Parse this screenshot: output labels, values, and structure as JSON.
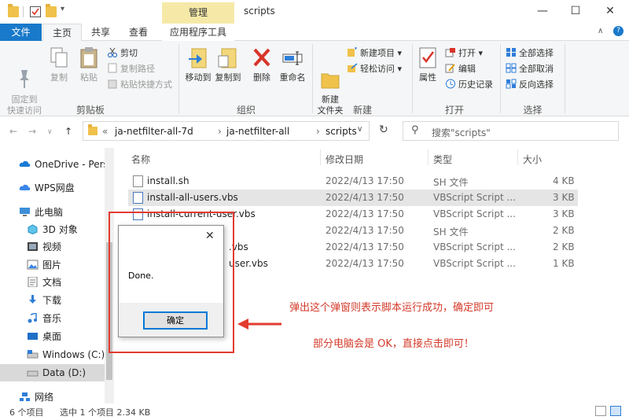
{
  "window": {
    "title": "scripts",
    "context_tab": "管理",
    "controls": [
      "—",
      "☐",
      "✕"
    ]
  },
  "ribbon_tabs": {
    "file": "文件",
    "home": "主页",
    "share": "共享",
    "view": "查看",
    "app_tools": "应用程序工具"
  },
  "clipboard": {
    "label": "剪贴板",
    "pin": "固定到\n快速访问",
    "copy": "复制",
    "paste": "粘贴",
    "cut": "剪切",
    "copy_path": "复制路径",
    "paste_shortcut": "粘贴快捷方式"
  },
  "organize": {
    "label": "组织",
    "move_to": "移动到",
    "copy_to": "复制到",
    "delete": "删除",
    "rename": "重命名"
  },
  "new_group": {
    "label": "新建",
    "new_folder": "新建\n文件夹",
    "new_item": "新建项目",
    "easy_access": "轻松访问"
  },
  "open_group": {
    "label": "打开",
    "properties": "属性",
    "open": "打开",
    "edit": "编辑",
    "history": "历史记录"
  },
  "select_group": {
    "label": "选择",
    "select_all": "全部选择",
    "select_none": "全部取消",
    "invert": "反向选择"
  },
  "address": {
    "crumbs": [
      "«",
      "ja-netfilter-all-7d",
      "ja-netfilter-all",
      "scripts"
    ],
    "search_placeholder": "搜索\"scripts\""
  },
  "nav": [
    {
      "label": "OneDrive - Pers",
      "icon": "cloud-icon"
    },
    {
      "label": "WPS网盘",
      "icon": "cloud-icon"
    },
    {
      "label": "此电脑",
      "icon": "computer-icon"
    },
    {
      "label": "3D 对象",
      "icon": "cube-icon"
    },
    {
      "label": "视频",
      "icon": "video-icon"
    },
    {
      "label": "图片",
      "icon": "picture-icon"
    },
    {
      "label": "文档",
      "icon": "document-icon"
    },
    {
      "label": "下载",
      "icon": "download-icon"
    },
    {
      "label": "音乐",
      "icon": "music-icon"
    },
    {
      "label": "桌面",
      "icon": "desktop-icon"
    },
    {
      "label": "Windows (C:)",
      "icon": "drive-icon"
    },
    {
      "label": "Data (D:)",
      "icon": "drive-icon"
    },
    {
      "label": "网络",
      "icon": "network-icon"
    }
  ],
  "columns": {
    "name": "名称",
    "date": "修改日期",
    "type": "类型",
    "size": "大小"
  },
  "files": [
    {
      "name": "install.sh",
      "date": "2022/4/13 17:50",
      "type": "SH 文件",
      "size": "4 KB"
    },
    {
      "name": "install-all-users.vbs",
      "date": "2022/4/13 17:50",
      "type": "VBScript Script ...",
      "size": "3 KB"
    },
    {
      "name": "install-current-user.vbs",
      "date": "2022/4/13 17:50",
      "type": "VBScript Script ...",
      "size": "3 KB"
    },
    {
      "name": "",
      "date": "2022/4/13 17:50",
      "type": "SH 文件",
      "size": "2 KB"
    },
    {
      "name": ".vbs",
      "date": "2022/4/13 17:50",
      "type": "VBScript Script ...",
      "size": "2 KB"
    },
    {
      "name": "user.vbs",
      "date": "2022/4/13 17:50",
      "type": "VBScript Script ...",
      "size": "1 KB"
    }
  ],
  "status": {
    "count": "6 个项目",
    "selected": "选中 1 个项目  2.34 KB"
  },
  "dialog": {
    "message": "Done.",
    "ok": "确定",
    "close": "✕"
  },
  "annotations": {
    "line1": "弹出这个弹窗则表示脚本运行成功，确定即可",
    "line2": "部分电脑会是 OK，直接点击即可！"
  }
}
